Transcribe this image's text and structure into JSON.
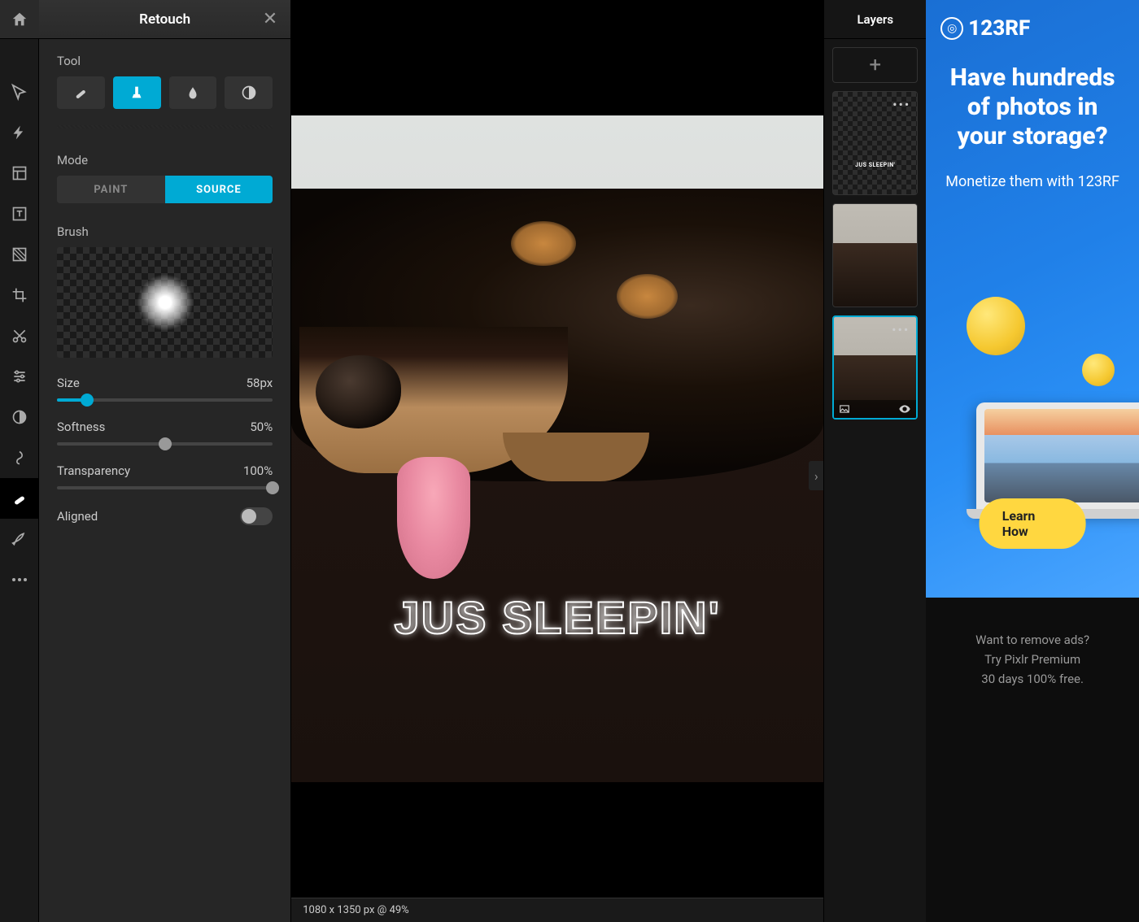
{
  "panel": {
    "title": "Retouch",
    "tool_label": "Tool",
    "tools": [
      "heal",
      "clone",
      "blur",
      "sharpen"
    ],
    "selected_tool": 1,
    "mode_label": "Mode",
    "modes": [
      "PAINT",
      "SOURCE"
    ],
    "selected_mode": 1,
    "brush_label": "Brush",
    "sliders": {
      "size": {
        "label": "Size",
        "value": "58px",
        "percent": 14
      },
      "softness": {
        "label": "Softness",
        "value": "50%",
        "percent": 50
      },
      "transparency": {
        "label": "Transparency",
        "value": "100%",
        "percent": 100
      }
    },
    "aligned_label": "Aligned"
  },
  "canvas": {
    "overlay_text": "JUS SLEEPIN'",
    "status": "1080 x 1350 px @ 49%"
  },
  "layers": {
    "title": "Layers",
    "text_layer_overlay": "JUS SLEEPIN'"
  },
  "ad": {
    "logo": "123RF",
    "headline": "Have hundreds of photos in your storage?",
    "sub": "Monetize them with 123RF",
    "cta": "Learn How",
    "footer_line1": "Want to remove ads?",
    "footer_line2": "Try Pixlr Premium",
    "footer_line3": "30 days 100% free."
  }
}
